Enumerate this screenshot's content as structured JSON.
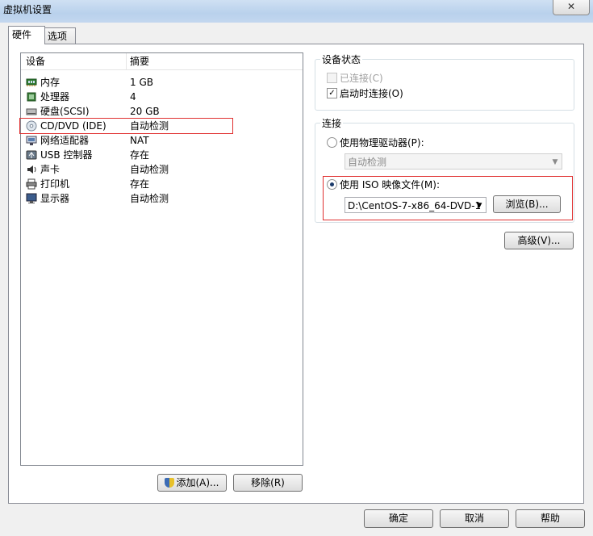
{
  "window": {
    "title": "虚拟机设置",
    "close_label": "✕"
  },
  "tabs": [
    {
      "label": "硬件"
    },
    {
      "label": "选项"
    }
  ],
  "hardware": {
    "col_device": "设备",
    "col_summary": "摘要",
    "rows": [
      {
        "device": "内存",
        "summary": "1 GB",
        "icon": "memory-icon"
      },
      {
        "device": "处理器",
        "summary": "4",
        "icon": "processor-icon"
      },
      {
        "device": "硬盘(SCSI)",
        "summary": "20 GB",
        "icon": "hard-disk-icon"
      },
      {
        "device": "CD/DVD (IDE)",
        "summary": "自动检测",
        "icon": "cd-dvd-icon"
      },
      {
        "device": "网络适配器",
        "summary": "NAT",
        "icon": "network-adapter-icon"
      },
      {
        "device": "USB 控制器",
        "summary": "存在",
        "icon": "usb-icon"
      },
      {
        "device": "声卡",
        "summary": "自动检测",
        "icon": "sound-card-icon"
      },
      {
        "device": "打印机",
        "summary": "存在",
        "icon": "printer-icon"
      },
      {
        "device": "显示器",
        "summary": "自动检测",
        "icon": "display-icon"
      }
    ],
    "add_button": "添加(A)...",
    "remove_button": "移除(R)"
  },
  "device_status": {
    "title": "设备状态",
    "connected_label": "已连接(C)",
    "connected_checked": false,
    "connect_on_start_label": "启动时连接(O)",
    "connect_on_start_checked": true
  },
  "connection": {
    "title": "连接",
    "physical_label": "使用物理驱动器(P):",
    "physical_value": "自动检测",
    "iso_label": "使用 ISO 映像文件(M):",
    "iso_value": "D:\\CentOS-7-x86_64-DVD-1",
    "browse_button": "浏览(B)...",
    "selected": "iso"
  },
  "advanced_button": "高级(V)...",
  "footer": {
    "ok": "确定",
    "cancel": "取消",
    "help": "帮助"
  },
  "colors": {
    "highlight_border": "#e03030"
  }
}
